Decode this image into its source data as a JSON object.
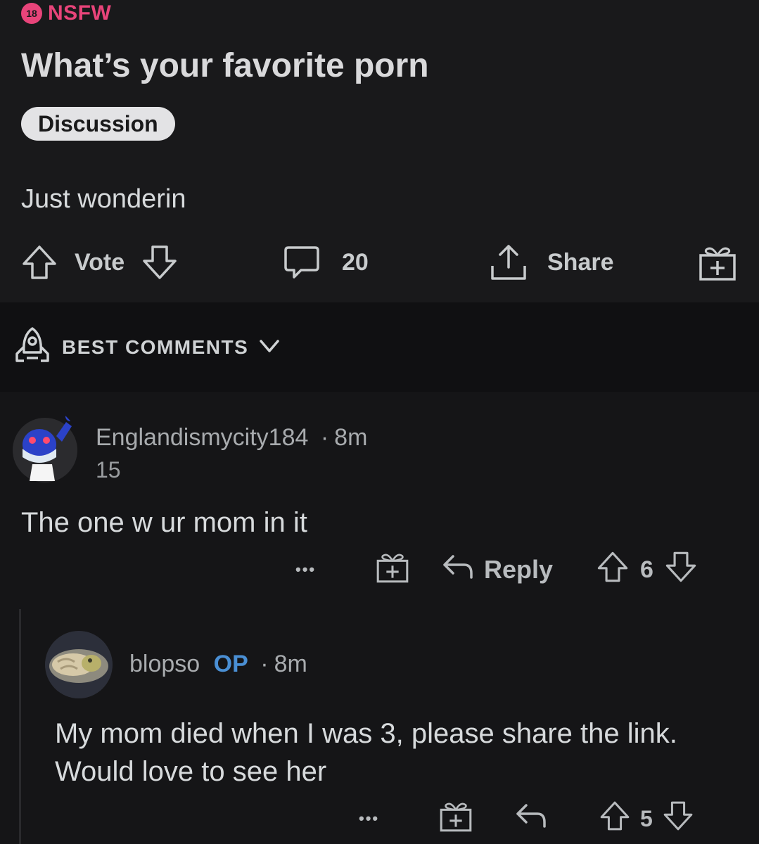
{
  "post": {
    "nsfw_badge": "18",
    "nsfw_label": "NSFW",
    "title": "What’s your favorite porn",
    "flair": "Discussion",
    "body": "Just wonderin",
    "actions": {
      "vote_label": "Vote",
      "comment_count": "20",
      "share_label": "Share"
    }
  },
  "sort": {
    "label": "BEST COMMENTS"
  },
  "comments": [
    {
      "username": "Englandismycity184",
      "separator": "·",
      "time": "8m",
      "score": "15",
      "text": "The one w ur mom in it",
      "more": "•••",
      "reply_label": "Reply",
      "votes": "6"
    },
    {
      "username": "blopso",
      "op_tag": "OP",
      "separator": "·",
      "time": "8m",
      "text": "My mom died when I was 3, please share the link. Would love to see her",
      "more": "•••",
      "votes": "5"
    }
  ],
  "colors": {
    "nsfw": "#e8447a",
    "op": "#4a8fd4",
    "background": "#151517"
  }
}
